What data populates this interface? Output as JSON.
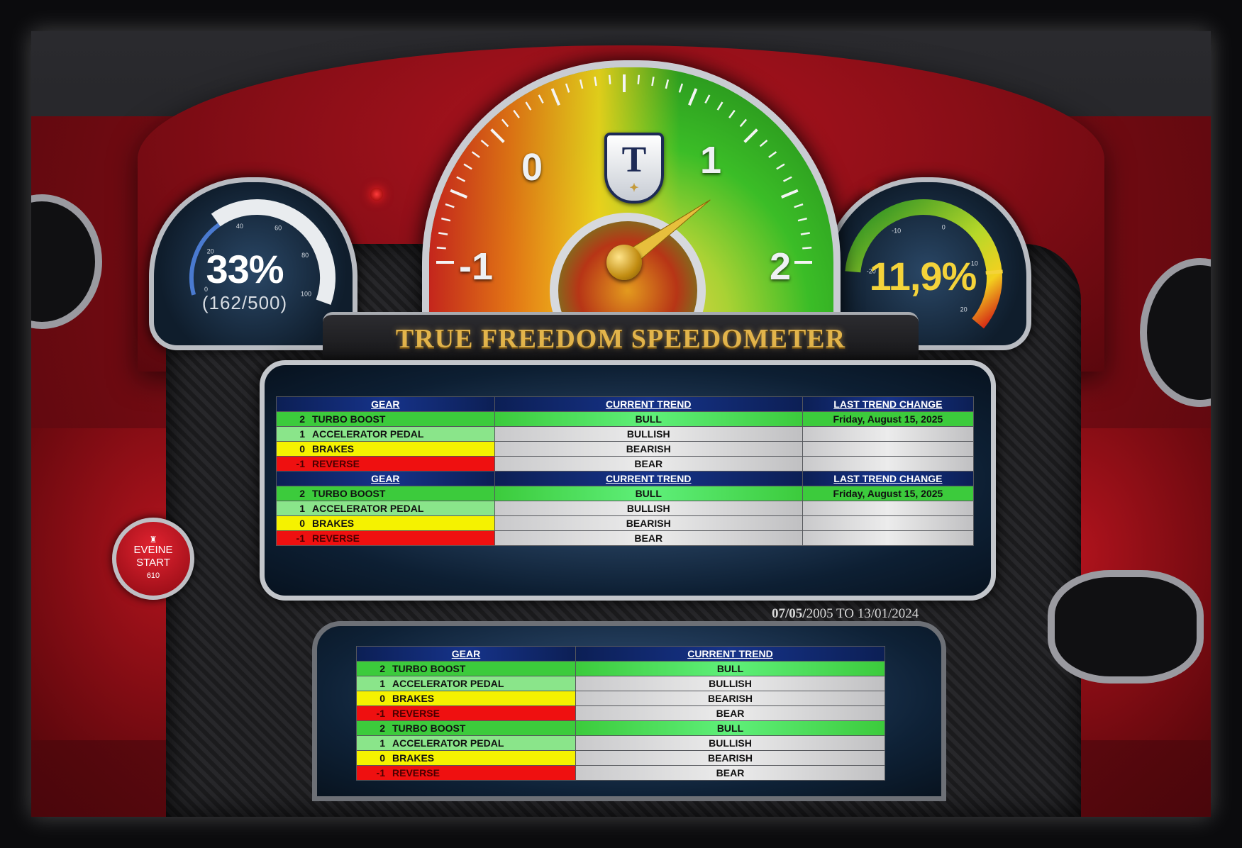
{
  "left_gauge": {
    "percent_label": "33%",
    "count_label": "(162/500)",
    "fill_fraction": 0.324,
    "scale_ticks": [
      "0",
      "20",
      "40",
      "60",
      "80",
      "100"
    ]
  },
  "right_gauge": {
    "value_label": "11,9%",
    "fill_fraction": 0.81,
    "scale_ticks": [
      "-20",
      "-10",
      "0",
      "10",
      "20"
    ]
  },
  "center_gauge": {
    "labels": [
      "-1",
      "0",
      "1",
      "2"
    ],
    "badge_letter": "T",
    "needle_value": 1.4
  },
  "start_button": {
    "line1": "EVEINE",
    "line2": "START",
    "line3": "610"
  },
  "title": "TRUE FREEDOM SPEEDOMETER",
  "date_range": {
    "start_bold": "07/05/",
    "start_rest": "2005",
    "joiner": " TO ",
    "end": "13/01/2024"
  },
  "top_table": {
    "headers": [
      "GEAR",
      "CURRENT TREND",
      "LAST TREND CHANGE"
    ],
    "blocks": [
      {
        "rows": [
          {
            "num": "2",
            "label": "TURBO BOOST",
            "trend": "BULL",
            "change": "Friday, August 15, 2025"
          },
          {
            "num": "1",
            "label": "ACCELERATOR PEDAL",
            "trend": "BULLISH",
            "change": ""
          },
          {
            "num": "0",
            "label": "BRAKES",
            "trend": "BEARISH",
            "change": ""
          },
          {
            "num": "-1",
            "label": "REVERSE",
            "trend": "BEAR",
            "change": ""
          }
        ]
      },
      {
        "rows": [
          {
            "num": "2",
            "label": "TURBO BOOST",
            "trend": "BULL",
            "change": "Friday, August 15, 2025"
          },
          {
            "num": "1",
            "label": "ACCELERATOR PEDAL",
            "trend": "BULLISH",
            "change": ""
          },
          {
            "num": "0",
            "label": "BRAKES",
            "trend": "BEARISH",
            "change": ""
          },
          {
            "num": "-1",
            "label": "REVERSE",
            "trend": "BEAR",
            "change": ""
          }
        ]
      }
    ]
  },
  "bottom_table": {
    "headers": [
      "GEAR",
      "CURRENT TREND"
    ],
    "rows": [
      {
        "num": "2",
        "label": "TURBO BOOST",
        "trend": "BULL"
      },
      {
        "num": "1",
        "label": "ACCELERATOR PEDAL",
        "trend": "BULLISH"
      },
      {
        "num": "0",
        "label": "BRAKES",
        "trend": "BEARISH"
      },
      {
        "num": "-1",
        "label": "REVERSE",
        "trend": "BEAR"
      },
      {
        "num": "2",
        "label": "TURBO BOOST",
        "trend": "BULL"
      },
      {
        "num": "1",
        "label": "ACCELERATOR PEDAL",
        "trend": "BULLISH"
      },
      {
        "num": "0",
        "label": "BRAKES",
        "trend": "BEARISH"
      },
      {
        "num": "-1",
        "label": "REVERSE",
        "trend": "BEAR"
      }
    ]
  },
  "colors": {
    "turbo": "#3ccb3c",
    "accelerator": "#8ae58a",
    "brakes": "#f5f200",
    "reverse": "#ef1010",
    "header_navy": "#16338a",
    "title_gold": "#e2b44b"
  }
}
